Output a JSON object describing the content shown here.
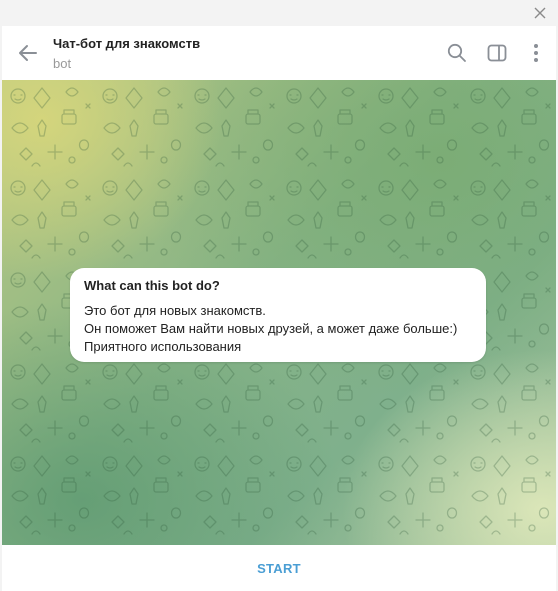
{
  "chat": {
    "title": "Чат-бот для знакомств",
    "subtitle": "bot"
  },
  "info_card": {
    "title": "What can this bot do?",
    "lines": [
      "Это бот для новых знакомств.",
      "Он поможет Вам найти новых друзей, а может даже больше:)",
      "Приятного использования"
    ]
  },
  "footer": {
    "start_label": "START"
  },
  "icons": {
    "close": "close-icon",
    "back": "arrow-left-icon",
    "search": "search-icon",
    "sidebar": "sidebar-toggle-icon",
    "menu": "more-vertical-icon"
  },
  "colors": {
    "accent": "#4a9ed4",
    "bubble": "#ffffff",
    "title_text": "#222222",
    "subtitle_text": "#999999"
  }
}
